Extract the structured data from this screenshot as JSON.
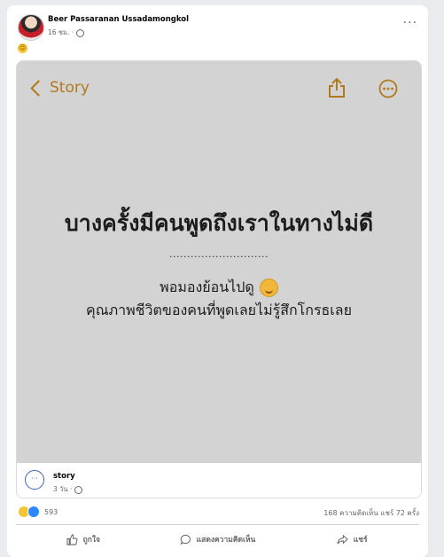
{
  "post": {
    "author": "Beer Passaranan Ussadamongkol",
    "time": "16 ชม. ·",
    "body_emoji": "☺"
  },
  "shared_image": {
    "back_label": "Story",
    "headline": "บางครั้งมีคนพูดถึงเราในทางไม่ดี",
    "dots": "............................",
    "line2": "พอมองย้อนไปดู",
    "line3": "คุณภาพชีวิตของคนที่พูดเลยไม่รู้สึกโกรธเลย",
    "accent_color": "#b1791b"
  },
  "source": {
    "name": "story",
    "time": "3 วัน ·",
    "avatar_glyph": "···"
  },
  "stats": {
    "reaction_count": "593",
    "comments_shares": "168 ความคิดเห็น  แชร์ 72 ครั้ง"
  },
  "actions": {
    "like": "ถูกใจ",
    "comment": "แสดงความคิดเห็น",
    "share": "แชร์"
  }
}
